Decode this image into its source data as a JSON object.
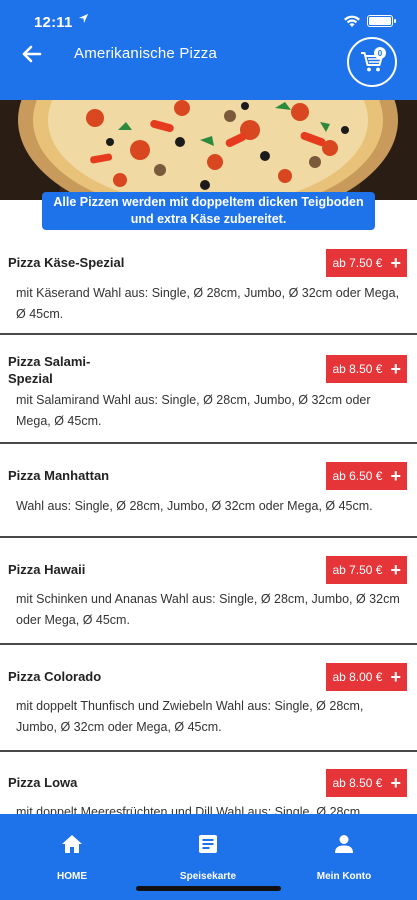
{
  "status_bar": {
    "time": "12:11"
  },
  "header": {
    "title": "Amerikanische Pizza",
    "cart_count": "0"
  },
  "banner": {
    "line1": "Alle Pizzen werden mit doppeltem dicken Teigboden",
    "line2": "und extra Käse zubereitet."
  },
  "items": [
    {
      "name": "Pizza Käse-Spezial",
      "price": "ab 7.50 €",
      "desc": "mit Käserand Wahl aus: Single, Ø 28cm, Jumbo, Ø 32cm oder Mega, Ø 45cm."
    },
    {
      "name": "Pizza Salami-Spezial",
      "price": "ab 8.50 €",
      "desc": "mit Salamirand Wahl aus: Single, Ø 28cm, Jumbo, Ø 32cm oder Mega, Ø 45cm."
    },
    {
      "name": "Pizza Manhattan",
      "price": "ab 6.50 €",
      "desc": "Wahl aus: Single, Ø 28cm, Jumbo, Ø 32cm oder Mega, Ø 45cm."
    },
    {
      "name": "Pizza Hawaii",
      "price": "ab 7.50 €",
      "desc": "mit Schinken und Ananas Wahl aus: Single, Ø 28cm, Jumbo, Ø 32cm oder Mega, Ø 45cm."
    },
    {
      "name": "Pizza Colorado",
      "price": "ab 8.00 €",
      "desc": "mit doppelt Thunfisch und Zwiebeln Wahl aus: Single, Ø 28cm, Jumbo, Ø 32cm oder Mega, Ø 45cm."
    },
    {
      "name": "Pizza Lowa",
      "price": "ab 8.50 €",
      "desc": "mit doppelt Meeresfrüchten und Dill Wahl aus: Single, Ø 28cm,"
    }
  ],
  "bottom_nav": {
    "home": "HOME",
    "menu": "Speisekarte",
    "account": "Mein Konto"
  },
  "colors": {
    "primary": "#1f73ea",
    "price": "#e53539"
  }
}
